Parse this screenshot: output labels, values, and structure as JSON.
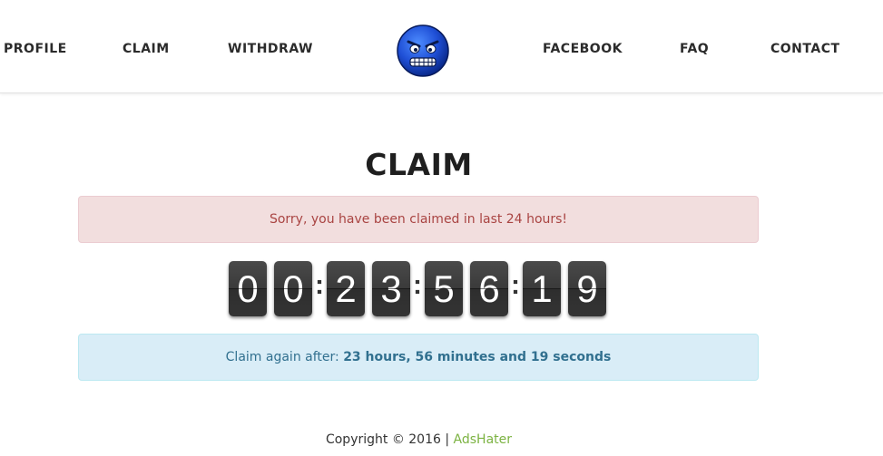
{
  "nav": {
    "profile": "PROFILE",
    "claim": "CLAIM",
    "withdraw": "WITHDRAW",
    "facebook": "FACEBOOK",
    "faq": "FAQ",
    "contact": "CONTACT",
    "logo_icon": "angry-face-icon"
  },
  "main": {
    "title": "CLAIM",
    "alert_message": "Sorry, you have been claimed in last 24 hours!",
    "countdown": {
      "hours": [
        "0",
        "0"
      ],
      "minutes": [
        "2",
        "3"
      ],
      "seconds": [
        "5",
        "6"
      ],
      "extra": [
        "1",
        "9"
      ],
      "separator": ":"
    },
    "info_prefix": "Claim again after: ",
    "info_time": "23 hours, 56 minutes and 19 seconds"
  },
  "footer": {
    "copyright": "Copyright © 2016 | ",
    "brand": "AdsHater"
  },
  "colors": {
    "danger_bg": "#f2dede",
    "danger_text": "#a94442",
    "info_bg": "#d9edf7",
    "info_text": "#31708f",
    "brand_green": "#7cb342",
    "digit_bg": "#3a3a3a"
  }
}
